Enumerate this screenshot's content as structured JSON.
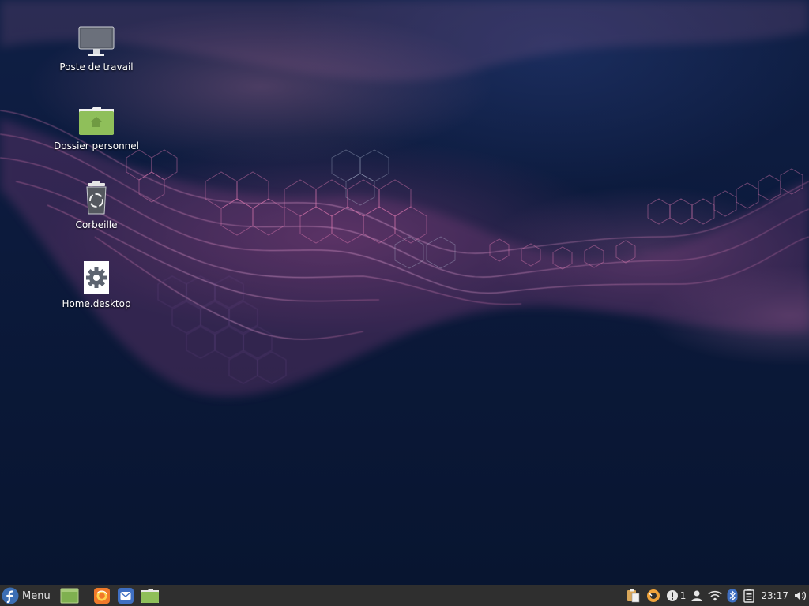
{
  "desktop": {
    "icons": [
      {
        "name": "computer-icon",
        "label": "Poste de travail"
      },
      {
        "name": "home-folder-icon",
        "label": "Dossier personnel"
      },
      {
        "name": "trash-icon",
        "label": "Corbeille"
      },
      {
        "name": "settings-gear-icon",
        "label": "Home.desktop"
      }
    ]
  },
  "taskbar": {
    "menu_label": "Menu",
    "launchers": [
      "show-desktop-icon",
      "firefox-icon",
      "mail-icon",
      "file-manager-icon"
    ],
    "tray": {
      "icons": [
        "clipboard-icon",
        "update-manager-icon",
        "notification-icon",
        "user-icon",
        "wifi-icon",
        "bluetooth-icon",
        "battery-icon",
        "volume-icon"
      ],
      "notification_count": "1",
      "clock": "23:17"
    }
  },
  "colors": {
    "taskbar_bg": "#2f2f2f",
    "folder_green": "#8fbf5a",
    "wallpaper_dark": "#0c1a3c",
    "wallpaper_accent": "#b0508f"
  }
}
